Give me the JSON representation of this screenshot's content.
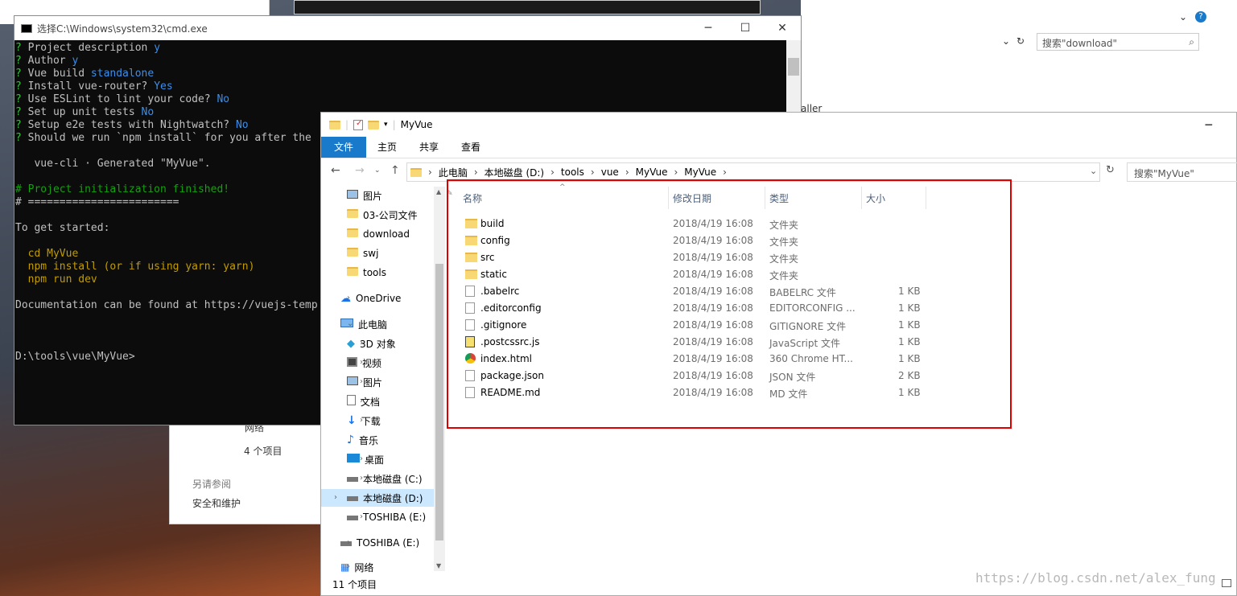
{
  "background": {
    "right_search_placeholder": "搜索\"download\"",
    "right_partial_text": "aller",
    "bottom_status": "4 个项目",
    "bottom_link_header": "另请参阅",
    "bottom_link": "安全和维护",
    "bottom_partial": "网络"
  },
  "cmd": {
    "title": "选择C:\\Windows\\system32\\cmd.exe",
    "lines": [
      {
        "prompt": "?",
        "text": " Project description ",
        "value": "y"
      },
      {
        "prompt": "?",
        "text": " Author ",
        "value": "y"
      },
      {
        "prompt": "?",
        "text": " Vue build ",
        "value": "standalone"
      },
      {
        "prompt": "?",
        "text": " Install vue-router? ",
        "value": "Yes"
      },
      {
        "prompt": "?",
        "text": " Use ESLint to lint your code? ",
        "value": "No"
      },
      {
        "prompt": "?",
        "text": " Set up unit tests ",
        "value": "No"
      },
      {
        "prompt": "?",
        "text": " Setup e2e tests with Nightwatch? ",
        "value": "No"
      },
      {
        "prompt": "?",
        "text": " Should we run `npm install` for you after the",
        "value": ""
      }
    ],
    "generated": "   vue-cli · Generated \"MyVue\".",
    "finished": "# Project initialization finished!",
    "rule": "# ========================",
    "get_started": "To get started:",
    "cmd1": "  cd MyVue",
    "cmd2": "  npm install (or if using yarn: yarn)",
    "cmd3": "  npm run dev",
    "docs": "Documentation can be found at https://vuejs-temp",
    "prompt_line": "D:\\tools\\vue\\MyVue>"
  },
  "explorer": {
    "title": "MyVue",
    "ribbon": [
      "文件",
      "主页",
      "共享",
      "查看"
    ],
    "breadcrumb": [
      "此电脑",
      "本地磁盘 (D:)",
      "tools",
      "vue",
      "MyVue",
      "MyVue"
    ],
    "search_placeholder": "搜索\"MyVue\"",
    "nav": {
      "quick": [
        "图片",
        "03-公司文件",
        "download",
        "swj",
        "tools"
      ],
      "onedrive": "OneDrive",
      "thispc": "此电脑",
      "pc_items": [
        "3D 对象",
        "视频",
        "图片",
        "文档",
        "下载",
        "音乐",
        "桌面",
        "本地磁盘 (C:)",
        "本地磁盘 (D:)",
        "TOSHIBA (E:)"
      ],
      "toshiba": "TOSHIBA (E:)",
      "network": "网络"
    },
    "columns": {
      "name": "名称",
      "date": "修改日期",
      "type": "类型",
      "size": "大小"
    },
    "files": [
      {
        "name": "build",
        "date": "2018/4/19 16:08",
        "type": "文件夹",
        "size": "",
        "kind": "folder"
      },
      {
        "name": "config",
        "date": "2018/4/19 16:08",
        "type": "文件夹",
        "size": "",
        "kind": "folder"
      },
      {
        "name": "src",
        "date": "2018/4/19 16:08",
        "type": "文件夹",
        "size": "",
        "kind": "folder"
      },
      {
        "name": "static",
        "date": "2018/4/19 16:08",
        "type": "文件夹",
        "size": "",
        "kind": "folder"
      },
      {
        "name": ".babelrc",
        "date": "2018/4/19 16:08",
        "type": "BABELRC 文件",
        "size": "1 KB",
        "kind": "file"
      },
      {
        "name": ".editorconfig",
        "date": "2018/4/19 16:08",
        "type": "EDITORCONFIG ...",
        "size": "1 KB",
        "kind": "file"
      },
      {
        "name": ".gitignore",
        "date": "2018/4/19 16:08",
        "type": "GITIGNORE 文件",
        "size": "1 KB",
        "kind": "file"
      },
      {
        "name": ".postcssrc.js",
        "date": "2018/4/19 16:08",
        "type": "JavaScript 文件",
        "size": "1 KB",
        "kind": "js"
      },
      {
        "name": "index.html",
        "date": "2018/4/19 16:08",
        "type": "360 Chrome HT...",
        "size": "1 KB",
        "kind": "html"
      },
      {
        "name": "package.json",
        "date": "2018/4/19 16:08",
        "type": "JSON 文件",
        "size": "2 KB",
        "kind": "file"
      },
      {
        "name": "README.md",
        "date": "2018/4/19 16:08",
        "type": "MD 文件",
        "size": "1 KB",
        "kind": "file"
      }
    ],
    "status": "11 个项目"
  },
  "watermark": "https://blog.csdn.net/alex_fung"
}
